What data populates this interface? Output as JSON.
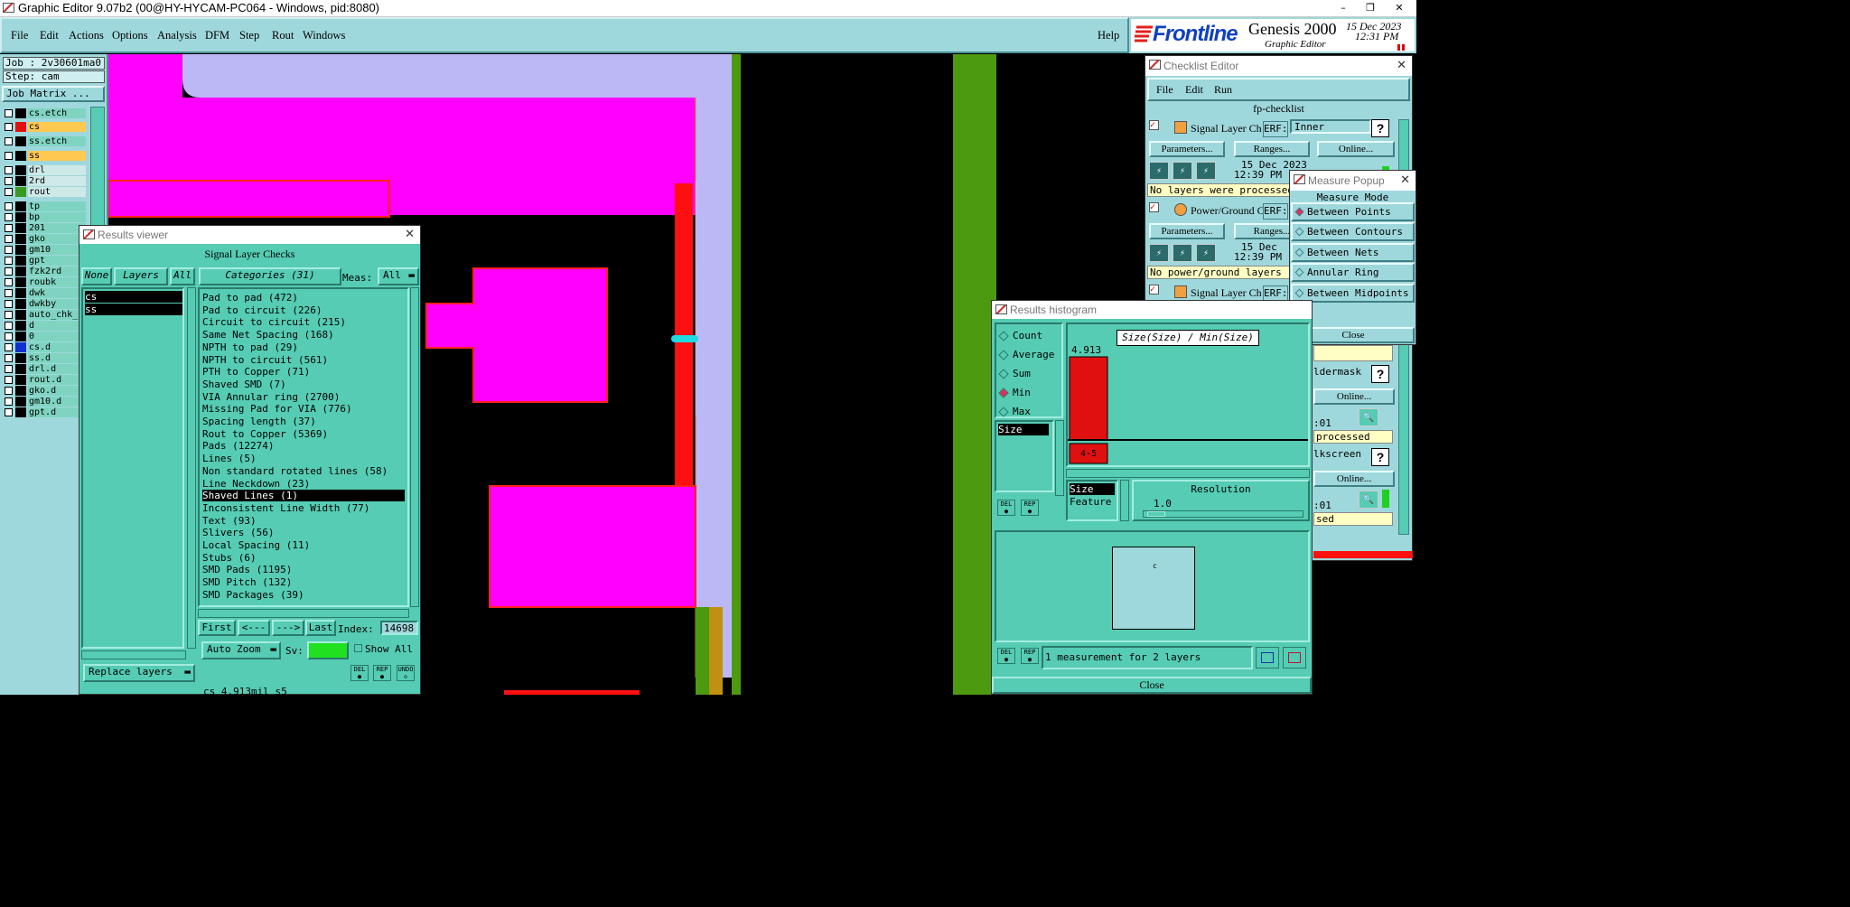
{
  "window": {
    "title": "Graphic Editor 9.07b2 (00@HY-HYCAM-PC064 - Windows, pid:8080)",
    "controls": [
      "–",
      "❐",
      "✕"
    ]
  },
  "menubar": {
    "items": [
      "File",
      "Edit",
      "Actions",
      "Options",
      "Analysis",
      "DFM",
      "Step",
      "Rout",
      "Windows"
    ],
    "help": "Help"
  },
  "logo": {
    "brand": "Frontline",
    "product": "Genesis 2000",
    "subtitle": "Graphic Editor",
    "date": "15 Dec 2023",
    "time": "12:31 PM"
  },
  "job": {
    "job_label": "Job : 2v30601ma0",
    "step_label": "Step: cam",
    "matrix_button": "Job Matrix ..."
  },
  "layers": [
    {
      "name": "cs.etch",
      "color": "#000000",
      "highlight": false
    },
    {
      "name": "cs",
      "color": "#e01010",
      "highlight": true
    },
    {
      "name": "ss.etch",
      "color": "#000000",
      "highlight": false
    },
    {
      "name": "ss",
      "color": "#000000",
      "highlight": true
    },
    {
      "name": "drl",
      "color": "#000000",
      "highlight": false
    },
    {
      "name": "2rd",
      "color": "#000000",
      "highlight": false
    },
    {
      "name": "rout",
      "color": "#3a9a20",
      "highlight": false
    },
    {
      "name": "tp",
      "color": "#000000",
      "highlight": false
    },
    {
      "name": "bp",
      "color": "#000000",
      "highlight": false
    },
    {
      "name": "201",
      "color": "#000000",
      "highlight": false
    },
    {
      "name": "gko",
      "color": "#000000",
      "highlight": false
    },
    {
      "name": "gm10",
      "color": "#000000",
      "highlight": false
    },
    {
      "name": "gpt",
      "color": "#000000",
      "highlight": false
    },
    {
      "name": "fzk2rd",
      "color": "#000000",
      "highlight": false
    },
    {
      "name": "roubk",
      "color": "#000000",
      "highlight": false
    },
    {
      "name": "dwk",
      "color": "#000000",
      "highlight": false
    },
    {
      "name": "dwkby",
      "color": "#000000",
      "highlight": false
    },
    {
      "name": "auto_chk_p",
      "color": "#000000",
      "highlight": false
    },
    {
      "name": "d",
      "color": "#000000",
      "highlight": false
    },
    {
      "name": "0",
      "color": "#000000",
      "highlight": false
    },
    {
      "name": "cs.d",
      "color": "#1030d0",
      "highlight": false
    },
    {
      "name": "ss.d",
      "color": "#000000",
      "highlight": false
    },
    {
      "name": "drl.d",
      "color": "#000000",
      "highlight": false
    },
    {
      "name": "rout.d",
      "color": "#000000",
      "highlight": false
    },
    {
      "name": "gko.d",
      "color": "#000000",
      "highlight": false
    },
    {
      "name": "gm10.d",
      "color": "#000000",
      "highlight": false
    },
    {
      "name": "gpt.d",
      "color": "#000000",
      "highlight": false
    }
  ],
  "results_viewer": {
    "title": "Results viewer",
    "header": "Signal Layer Checks",
    "none_btn": "None",
    "layers_btn": "Layers",
    "all_btn": "All",
    "categories_btn": "Categories (31)",
    "meas_label": "Meas:",
    "meas_value": "All",
    "layer_list": [
      "cs",
      "ss"
    ],
    "categories": [
      "Pad to pad (472)",
      "Pad to circuit (226)",
      "Circuit to circuit (215)",
      "Same Net Spacing (168)",
      "NPTH to pad (29)",
      "NPTH to circuit (561)",
      "PTH to Copper (71)",
      "Shaved SMD (7)",
      "VIA Annular ring (2700)",
      "Missing Pad for VIA (776)",
      "Spacing length (37)",
      "Rout to Copper (5369)",
      "Pads (12274)",
      "Lines (5)",
      "Non standard rotated lines (58)",
      "Line Neckdown (23)",
      "Shaved Lines (1)",
      "Inconsistent Line Width (77)",
      "Text (93)",
      "Slivers (56)",
      "Local Spacing (11)",
      "Stubs (6)",
      "SMD Pads (1195)",
      "SMD Pitch (132)",
      "SMD Packages (39)"
    ],
    "selected_category": "Shaved Lines (1)",
    "nav": {
      "first": "First",
      "prev": "<---",
      "next": "--->",
      "last": "Last",
      "index_label": "Index:",
      "index_value": "14698"
    },
    "auto_zoom": "Auto Zoom",
    "sv_label": "Sv:",
    "show_all": "Show All",
    "replace_layers": "Replace layers",
    "del": "DEL",
    "rep": "REP",
    "undo": "UNDO",
    "status": "cs 4.913mil  s5"
  },
  "checklist": {
    "title": "Checklist Editor",
    "menu": [
      "File",
      "Edit",
      "Run"
    ],
    "name": "fp-checklist",
    "items": [
      {
        "label": "Signal Layer Ch",
        "erf_label": "ERF:",
        "erf_value": "Inner",
        "params": "Parameters...",
        "ranges": "Ranges...",
        "online": "Online...",
        "date": "15 Dec 2023",
        "time": "12:39 PM -",
        "status": "No layers were processed"
      },
      {
        "label": "Power/Ground C",
        "erf_label": "ERF:",
        "params": "Parameters...",
        "ranges": "Ranges...",
        "date": "15 Dec",
        "time": "12:39 PM -",
        "status": "No power/ground layers"
      },
      {
        "label": "Signal Layer Ch",
        "erf_label": "ERF:"
      }
    ],
    "partial": {
      "soldermask": "ldermask",
      "online1": "Online...",
      "time1": ":01",
      "processed1": "processed",
      "silkscreen": "lkscreen",
      "online2": "Online...",
      "time2": ":01",
      "processed2": "sed"
    }
  },
  "measure_popup": {
    "title": "Measure Popup",
    "mode_label": "Measure Mode",
    "modes": [
      "Between Points",
      "Between Contours",
      "Between Nets",
      "Annular Ring",
      "Between Midpoints"
    ],
    "selected": "Between Points",
    "close": "Close"
  },
  "histogram": {
    "title": "Results histogram",
    "stats": [
      "Count",
      "Average",
      "Sum",
      "Min",
      "Max"
    ],
    "selected_stat": "Min",
    "attr_list": [
      "Size"
    ],
    "chart_title": "Size(Size) / Min(Size)",
    "bar_value_label": "4.913",
    "bin_label": "4-5",
    "resolution_list": [
      "Size",
      "Feature"
    ],
    "resolution_label": "Resolution",
    "resolution_value": "1.0",
    "preview_glyph": "c",
    "summary": "1 measurement for 2 layers",
    "close": "Close",
    "del": "DEL",
    "rep": "REP",
    "chart_data": {
      "type": "bar",
      "categories": [
        "4-5"
      ],
      "values": [
        4.913
      ],
      "title": "Size(Size) / Min(Size)"
    }
  },
  "colors": {
    "panel": "#9fd8dc",
    "dialog": "#55ccb3",
    "magenta": "#ff00ff",
    "lavender": "#bcb7f5",
    "green": "#4c9a10",
    "red": "#ff1010"
  }
}
